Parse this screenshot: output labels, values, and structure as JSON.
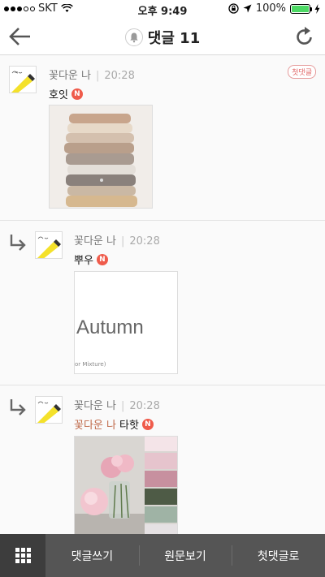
{
  "status_bar": {
    "carrier": "SKT",
    "time": "오후 9:49",
    "battery": "100%",
    "battery_level": 1.0
  },
  "header": {
    "title": "댓글 11",
    "back_icon": "arrow-left-icon",
    "refresh_icon": "refresh-icon",
    "bell_icon": "bell-icon"
  },
  "comments": [
    {
      "author": "꽃다운 나",
      "time": "20:28",
      "text": "호잇",
      "badge": "N",
      "first_label": "첫댓글",
      "image": "stacked knit sweaters photo"
    },
    {
      "author": "꽃다운 나",
      "time": "20:28",
      "text": "뿌우",
      "badge": "N",
      "image_text": "Autumn",
      "image_small_text": "or Mixture)"
    },
    {
      "author": "꽃다운 나",
      "time": "20:28",
      "mention": "꽃다운 나",
      "text": "타핫",
      "badge": "N",
      "image": "pink peonies with color swatches"
    }
  ],
  "bottom_bar": {
    "write": "댓글쓰기",
    "view_original": "원문보기",
    "to_first": "첫댓글로"
  }
}
